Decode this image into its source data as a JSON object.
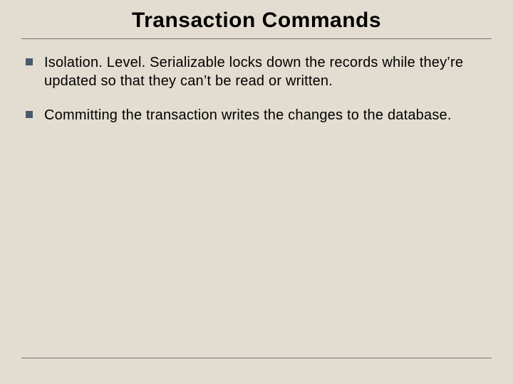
{
  "slide": {
    "title": "Transaction Commands",
    "bullets": [
      "Isolation. Level. Serializable locks down the records while they’re updated so that they can’t be read or written.",
      "Committing the transaction writes the changes to the database."
    ]
  }
}
